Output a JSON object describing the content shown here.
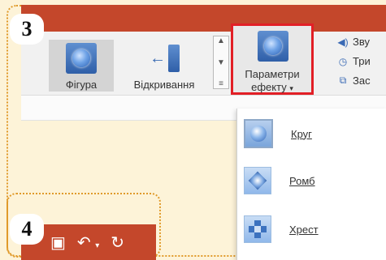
{
  "badges": {
    "top": "3",
    "bottom": "4"
  },
  "ribbon": {
    "shape_button": "Фігура",
    "opening_button": "Відкривання",
    "effect_params": {
      "line1": "Параметри",
      "line2": "ефекту",
      "caret": "▾"
    },
    "side_items": [
      {
        "label": "Зву",
        "icon": "speaker-icon"
      },
      {
        "label": "Три",
        "icon": "clock-icon"
      },
      {
        "label": "Зас",
        "icon": "window-icon"
      }
    ]
  },
  "dropdown": {
    "items": [
      {
        "label": "Круг",
        "icon": "circle-shape-icon",
        "selected": true
      },
      {
        "label": "Ромб",
        "icon": "diamond-shape-icon",
        "selected": false
      },
      {
        "label": "Хрест",
        "icon": "cross-shape-icon",
        "selected": false
      }
    ]
  },
  "quick_access": {
    "save": "save-icon",
    "undo": "undo-icon",
    "redo": "redo-icon"
  },
  "colors": {
    "title_bar": "#c4472b",
    "highlight_border": "#e21f26",
    "dotted_frame": "#e09a2a",
    "background": "#fdf3d8"
  }
}
